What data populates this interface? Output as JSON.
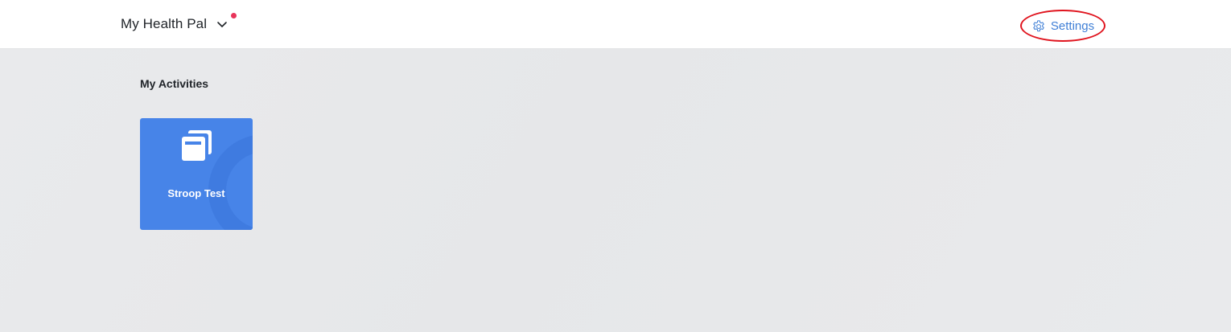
{
  "header": {
    "app_name": "My Health Pal",
    "app_switcher_icon": "chevron-down-icon",
    "notification_color": "#e8345a",
    "settings": {
      "label": "Settings",
      "icon": "gear-icon",
      "color": "#3f7fd6",
      "highlight_color": "#e0141e"
    }
  },
  "main": {
    "section_title": "My Activities",
    "activities": [
      {
        "label": "Stroop Test",
        "icon": "cards-stack-icon",
        "color": "#4784e8"
      }
    ]
  }
}
